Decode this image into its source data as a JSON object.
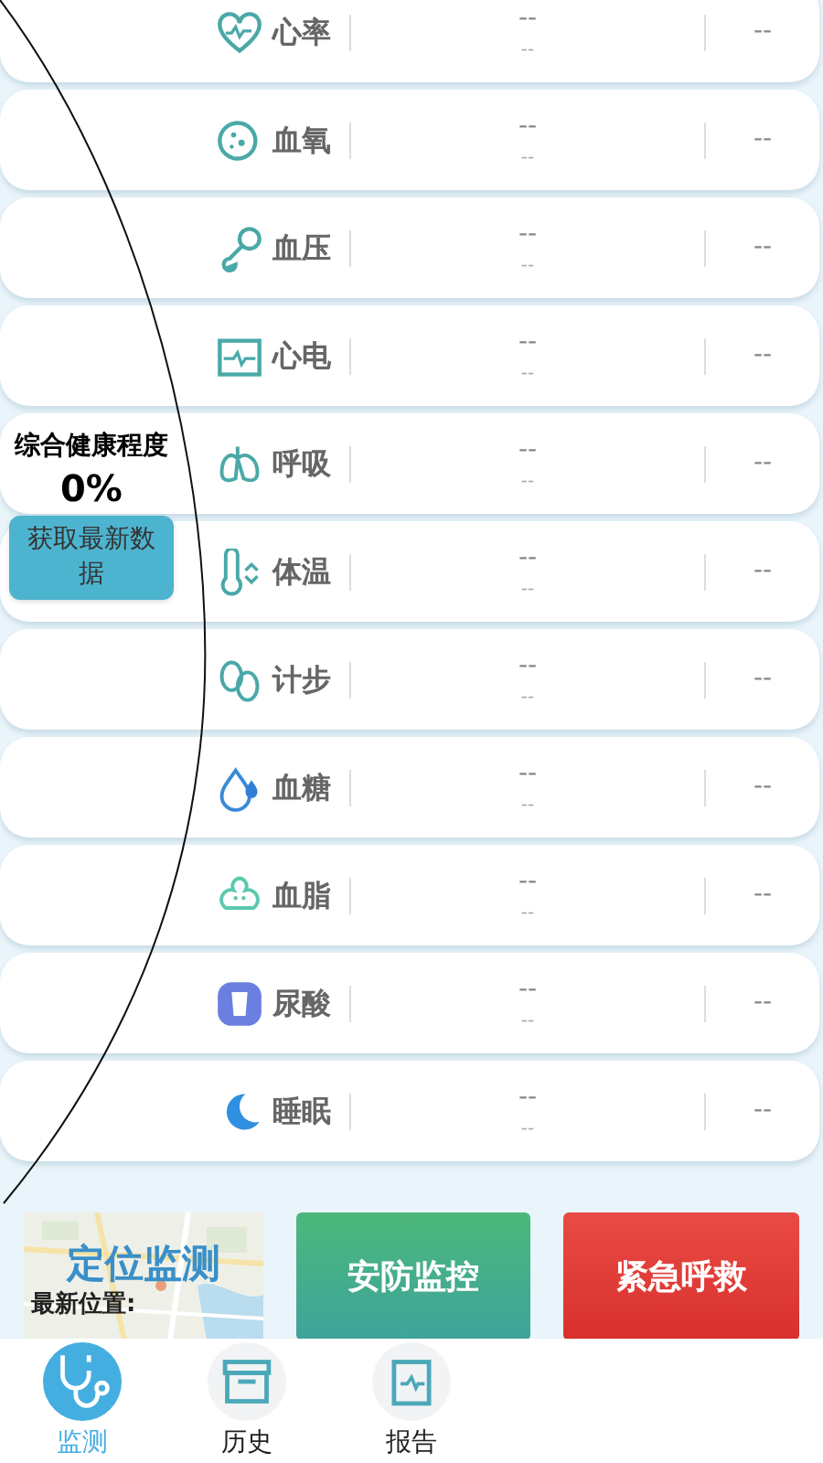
{
  "metrics": [
    {
      "label": "心率",
      "value": "--",
      "sub": "--",
      "extra": "--"
    },
    {
      "label": "血氧",
      "value": "--",
      "sub": "--",
      "extra": "--"
    },
    {
      "label": "血压",
      "value": "--",
      "sub": "--",
      "extra": "--"
    },
    {
      "label": "心电",
      "value": "--",
      "sub": "--",
      "extra": "--"
    },
    {
      "label": "呼吸",
      "value": "--",
      "sub": "--",
      "extra": "--"
    },
    {
      "label": "体温",
      "value": "--",
      "sub": "--",
      "extra": "--"
    },
    {
      "label": "计步",
      "value": "--",
      "sub": "--",
      "extra": "--"
    },
    {
      "label": "血糖",
      "value": "--",
      "sub": "--",
      "extra": "--"
    },
    {
      "label": "血脂",
      "value": "--",
      "sub": "--",
      "extra": "--"
    },
    {
      "label": "尿酸",
      "value": "--",
      "sub": "--",
      "extra": "--"
    },
    {
      "label": "睡眠",
      "value": "--",
      "sub": "--",
      "extra": "--"
    }
  ],
  "health": {
    "title": "综合健康程度",
    "percent": "0%",
    "button": "获取最新数据"
  },
  "actions": [
    {
      "kind": "map",
      "label": "定位监测",
      "note": "最新位置:"
    },
    {
      "kind": "green",
      "label": "安防监控"
    },
    {
      "kind": "red",
      "label": "紧急呼救"
    }
  ],
  "tabs": [
    {
      "label": "监测",
      "selected": true
    },
    {
      "label": "历史",
      "selected": false
    },
    {
      "label": "报告",
      "selected": false
    }
  ]
}
